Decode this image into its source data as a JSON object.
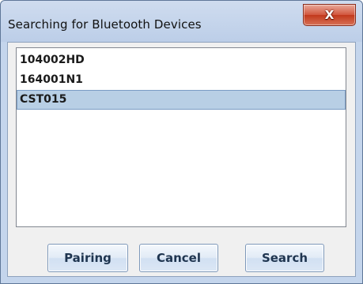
{
  "window": {
    "title": "Searching for Bluetooth Devices",
    "close_glyph": "X"
  },
  "devices": [
    {
      "name": "104002HD",
      "selected": false
    },
    {
      "name": "164001N1",
      "selected": false
    },
    {
      "name": "CST015",
      "selected": true
    }
  ],
  "buttons": {
    "pairing": "Pairing",
    "cancel": "Cancel",
    "search": "Search"
  }
}
